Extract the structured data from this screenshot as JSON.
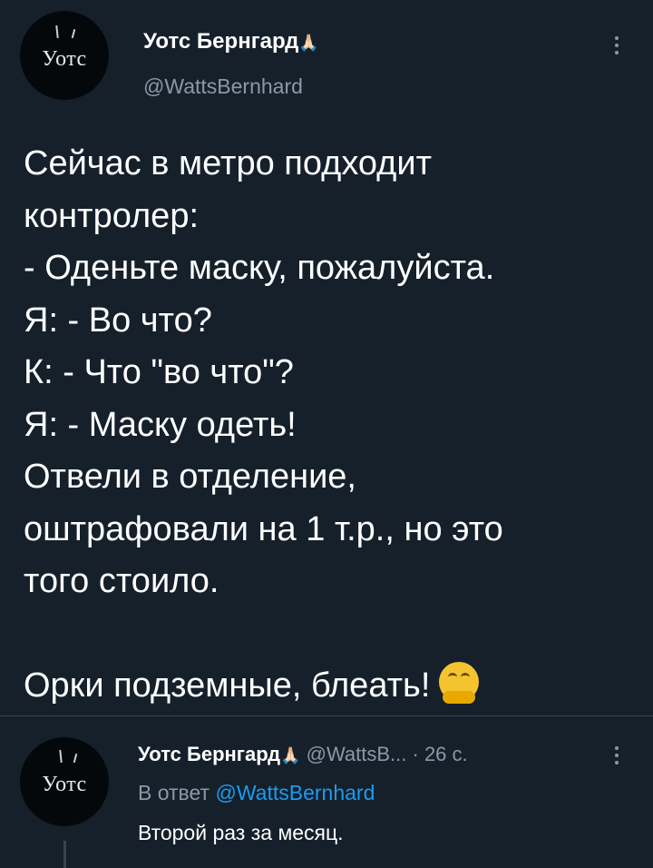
{
  "tweet": {
    "author_name": "Уотс Бернгард",
    "author_emoji": "🙏🏻",
    "handle": "@WattsBernhard",
    "avatar_text": "Уотс",
    "body_lines": [
      "Сейчас в метро подходит",
      "контролер:",
      "- Оденьте маску, пожалуйста.",
      "Я: - Во что?",
      "К: - Что \"во что\"?",
      "Я: - Маску одеть!",
      "Отвели в отделение,",
      "оштрафовали на 1 т.р., но это",
      "того стоило."
    ],
    "closing_line": "Орки подземные, блеать!",
    "closing_emoji": "hugging-face"
  },
  "reply": {
    "author_name": "Уотс Бернгард",
    "author_emoji": "🙏🏻",
    "handle_truncated": "@WattsB...",
    "time": "· 26 с.",
    "reply_to_prefix": "В ответ",
    "reply_to_handle": "@WattsBernhard",
    "text": "Второй раз за месяц.",
    "avatar_text": "Уотс"
  },
  "colors": {
    "background": "#15202b",
    "secondary_text": "#8b98a5",
    "link": "#1d9bf0",
    "divider": "#38444d"
  }
}
